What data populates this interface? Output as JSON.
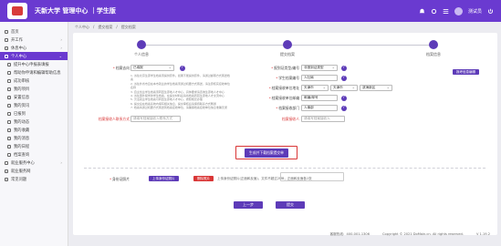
{
  "app": {
    "title": "天新大学 管理中心 ｜学生版",
    "username": "测试员"
  },
  "sidebar": {
    "items": [
      {
        "label": "首页",
        "expand": false
      },
      {
        "label": "开工作",
        "expand": true
      },
      {
        "label": "休息中心",
        "expand": true
      },
      {
        "label": "个人中心",
        "expand": true
      },
      {
        "label": "提升中心申报表填报",
        "expand": false
      },
      {
        "label": "帮助你申请和编辑帮助信息",
        "expand": false
      },
      {
        "label": "成功审核",
        "expand": false
      },
      {
        "label": "我的项目",
        "expand": false
      },
      {
        "label": "安置信息",
        "expand": false
      },
      {
        "label": "我的资讯",
        "expand": false
      },
      {
        "label": "已报到",
        "expand": false
      },
      {
        "label": "我的动态",
        "expand": false
      },
      {
        "label": "我的收藏",
        "expand": false
      },
      {
        "label": "我的消息",
        "expand": false
      },
      {
        "label": "我的日程",
        "expand": false
      },
      {
        "label": "档案查询",
        "expand": false
      },
      {
        "label": "就业服务中心",
        "expand": true
      },
      {
        "label": "就业服务网",
        "expand": false
      },
      {
        "label": "常见问题",
        "expand": false
      }
    ]
  },
  "breadcrumb": [
    "个人中心",
    "提交档案",
    "提交档案"
  ],
  "steps": [
    {
      "label": "个人信息"
    },
    {
      "label": "提交档案"
    },
    {
      "label": "档案信息"
    }
  ],
  "buttons": {
    "top_action": "报考信息编辑",
    "upload": "生成并下载档案提交单",
    "upload_photo": "上传身份证照片",
    "delete_photo": "删除照片",
    "prev": "上一步",
    "submit": "提交"
  },
  "form": {
    "archive_method_label": "档案去向",
    "archive_method_value": "已填报",
    "notes": [
      "1. 派往北京生源学生档案须提供原件。如果不能提供原件，请通过邮寄方式寄送档案",
      "2. 派往外省市且在本市就业的学生档案须通过机要方式寄送，请注意核实接收单位名称",
      "3. 自主创业学生档案须转回生源地人才中心，具体要求请咨询生源地人才中心",
      "4. 派往国外留学的学生档案，在提交材料后请将档案转回生源地人才交流中心",
      "5. 灵活就业学生档案可转回生源地人才中心，按照规定办理",
      "6. 提交后在档案系统内填写相关信息，提交审核后请保持联系方式畅通",
      "7. 档案将通过机要方式寄送到档案接收单位，请确保档案接收单位信息准确无误"
    ],
    "id_type_label": "报到证类型/编号",
    "id_type_value": "非报到证类型",
    "student_no_label": "学生档案编号",
    "student_no_value": "人社局",
    "receiver_unit_label": "档案接收单位地址",
    "province": "天津市",
    "city": "天津市",
    "district": "滨海新区",
    "postcode_label": "档案接收单位邮编",
    "postcode_value": "邮编/邮号",
    "receiver_dept_label": "档案接收部门",
    "receiver_dept_value": "人事部",
    "contact_label": "档案接收人联系方式",
    "contact_placeholder": "请填写档案接收人联系方式",
    "receiver_label": "档案接收人",
    "receiver_placeholder": "请填写档案接收人",
    "id_photo_label": "身份证照片",
    "upload_tip": "上传身份证照片(正面和反面)，文件不超过2MB，正面和反面各1张"
  },
  "footer": {
    "phone": "客服热线：400-001-1306",
    "copyright": "Copyright © 2021 DoMain.cn. All rights reserved.",
    "version": "V 1.19.2"
  }
}
